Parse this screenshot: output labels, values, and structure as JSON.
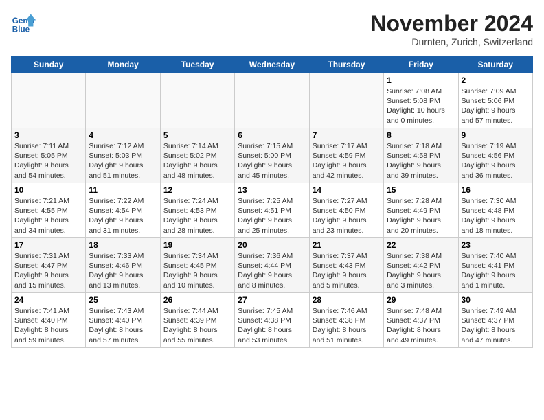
{
  "header": {
    "logo_line1": "General",
    "logo_line2": "Blue",
    "month": "November 2024",
    "location": "Durnten, Zurich, Switzerland"
  },
  "weekdays": [
    "Sunday",
    "Monday",
    "Tuesday",
    "Wednesday",
    "Thursday",
    "Friday",
    "Saturday"
  ],
  "weeks": [
    [
      {
        "day": "",
        "info": ""
      },
      {
        "day": "",
        "info": ""
      },
      {
        "day": "",
        "info": ""
      },
      {
        "day": "",
        "info": ""
      },
      {
        "day": "",
        "info": ""
      },
      {
        "day": "1",
        "info": "Sunrise: 7:08 AM\nSunset: 5:08 PM\nDaylight: 10 hours\nand 0 minutes."
      },
      {
        "day": "2",
        "info": "Sunrise: 7:09 AM\nSunset: 5:06 PM\nDaylight: 9 hours\nand 57 minutes."
      }
    ],
    [
      {
        "day": "3",
        "info": "Sunrise: 7:11 AM\nSunset: 5:05 PM\nDaylight: 9 hours\nand 54 minutes."
      },
      {
        "day": "4",
        "info": "Sunrise: 7:12 AM\nSunset: 5:03 PM\nDaylight: 9 hours\nand 51 minutes."
      },
      {
        "day": "5",
        "info": "Sunrise: 7:14 AM\nSunset: 5:02 PM\nDaylight: 9 hours\nand 48 minutes."
      },
      {
        "day": "6",
        "info": "Sunrise: 7:15 AM\nSunset: 5:00 PM\nDaylight: 9 hours\nand 45 minutes."
      },
      {
        "day": "7",
        "info": "Sunrise: 7:17 AM\nSunset: 4:59 PM\nDaylight: 9 hours\nand 42 minutes."
      },
      {
        "day": "8",
        "info": "Sunrise: 7:18 AM\nSunset: 4:58 PM\nDaylight: 9 hours\nand 39 minutes."
      },
      {
        "day": "9",
        "info": "Sunrise: 7:19 AM\nSunset: 4:56 PM\nDaylight: 9 hours\nand 36 minutes."
      }
    ],
    [
      {
        "day": "10",
        "info": "Sunrise: 7:21 AM\nSunset: 4:55 PM\nDaylight: 9 hours\nand 34 minutes."
      },
      {
        "day": "11",
        "info": "Sunrise: 7:22 AM\nSunset: 4:54 PM\nDaylight: 9 hours\nand 31 minutes."
      },
      {
        "day": "12",
        "info": "Sunrise: 7:24 AM\nSunset: 4:53 PM\nDaylight: 9 hours\nand 28 minutes."
      },
      {
        "day": "13",
        "info": "Sunrise: 7:25 AM\nSunset: 4:51 PM\nDaylight: 9 hours\nand 25 minutes."
      },
      {
        "day": "14",
        "info": "Sunrise: 7:27 AM\nSunset: 4:50 PM\nDaylight: 9 hours\nand 23 minutes."
      },
      {
        "day": "15",
        "info": "Sunrise: 7:28 AM\nSunset: 4:49 PM\nDaylight: 9 hours\nand 20 minutes."
      },
      {
        "day": "16",
        "info": "Sunrise: 7:30 AM\nSunset: 4:48 PM\nDaylight: 9 hours\nand 18 minutes."
      }
    ],
    [
      {
        "day": "17",
        "info": "Sunrise: 7:31 AM\nSunset: 4:47 PM\nDaylight: 9 hours\nand 15 minutes."
      },
      {
        "day": "18",
        "info": "Sunrise: 7:33 AM\nSunset: 4:46 PM\nDaylight: 9 hours\nand 13 minutes."
      },
      {
        "day": "19",
        "info": "Sunrise: 7:34 AM\nSunset: 4:45 PM\nDaylight: 9 hours\nand 10 minutes."
      },
      {
        "day": "20",
        "info": "Sunrise: 7:36 AM\nSunset: 4:44 PM\nDaylight: 9 hours\nand 8 minutes."
      },
      {
        "day": "21",
        "info": "Sunrise: 7:37 AM\nSunset: 4:43 PM\nDaylight: 9 hours\nand 5 minutes."
      },
      {
        "day": "22",
        "info": "Sunrise: 7:38 AM\nSunset: 4:42 PM\nDaylight: 9 hours\nand 3 minutes."
      },
      {
        "day": "23",
        "info": "Sunrise: 7:40 AM\nSunset: 4:41 PM\nDaylight: 9 hours\nand 1 minute."
      }
    ],
    [
      {
        "day": "24",
        "info": "Sunrise: 7:41 AM\nSunset: 4:40 PM\nDaylight: 8 hours\nand 59 minutes."
      },
      {
        "day": "25",
        "info": "Sunrise: 7:43 AM\nSunset: 4:40 PM\nDaylight: 8 hours\nand 57 minutes."
      },
      {
        "day": "26",
        "info": "Sunrise: 7:44 AM\nSunset: 4:39 PM\nDaylight: 8 hours\nand 55 minutes."
      },
      {
        "day": "27",
        "info": "Sunrise: 7:45 AM\nSunset: 4:38 PM\nDaylight: 8 hours\nand 53 minutes."
      },
      {
        "day": "28",
        "info": "Sunrise: 7:46 AM\nSunset: 4:38 PM\nDaylight: 8 hours\nand 51 minutes."
      },
      {
        "day": "29",
        "info": "Sunrise: 7:48 AM\nSunset: 4:37 PM\nDaylight: 8 hours\nand 49 minutes."
      },
      {
        "day": "30",
        "info": "Sunrise: 7:49 AM\nSunset: 4:37 PM\nDaylight: 8 hours\nand 47 minutes."
      }
    ]
  ]
}
